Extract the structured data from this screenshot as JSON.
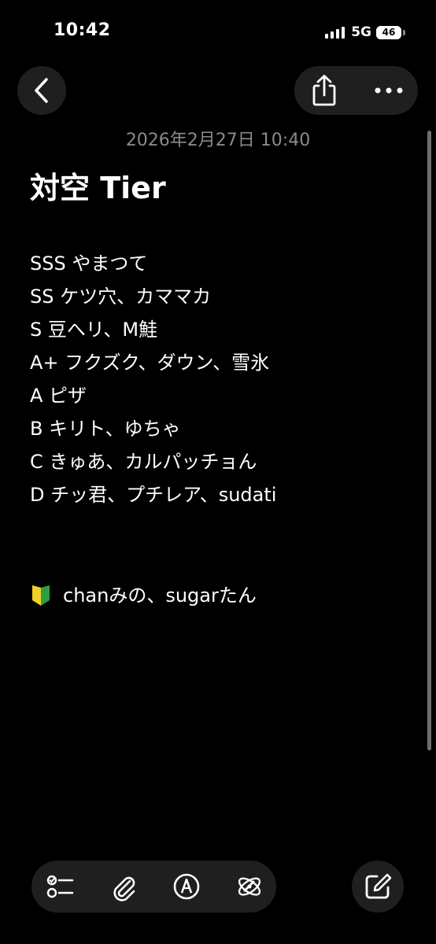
{
  "status_bar": {
    "time": "10:42",
    "network": "5G",
    "battery": "46"
  },
  "nav": {
    "back_icon": "chevron-left-icon",
    "share_icon": "share-icon",
    "more_icon": "ellipsis-icon"
  },
  "note": {
    "date": "2026年2月27日 10:40",
    "title": "対空 Tier",
    "lines": [
      "SSS やまつて",
      "SS ケツ穴、カママカ",
      "S 豆へリ、M鮭",
      "A+ フクズク、ダウン、雪氷",
      "A ピザ",
      "B キリト、ゆちゃ",
      "C きゅあ、カルパッチョん",
      "D チッ君、プチレア、sudati"
    ],
    "footer_icon": "beginner-mark-icon",
    "footer": "chanみの、sugarたん"
  },
  "toolbar": {
    "icons": [
      "checklist-icon",
      "attachment-icon",
      "markup-icon",
      "writing-tools-icon"
    ],
    "compose_icon": "compose-icon"
  },
  "colors": {
    "background": "#000000",
    "surface": "#1f1f1f",
    "text": "#ffffff",
    "secondary_text": "#8a8a8e",
    "beginner_green": "#2e9e3f",
    "beginner_yellow": "#f2d024"
  }
}
